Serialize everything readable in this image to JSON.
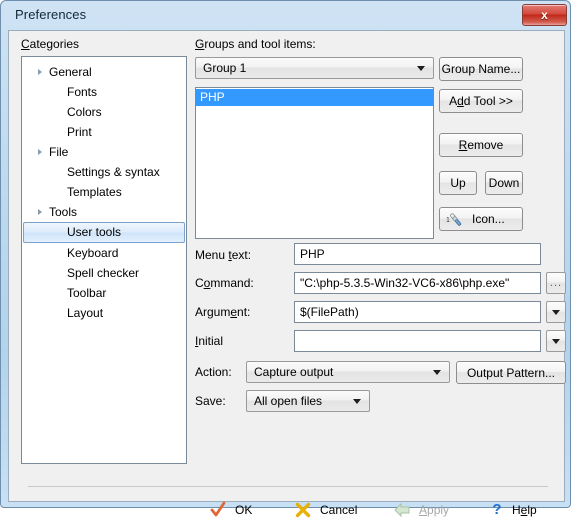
{
  "window": {
    "title": "Preferences",
    "close_label": "x",
    "close_icon": "close-icon"
  },
  "categories": {
    "label": "Categories",
    "label_accel": "C",
    "selected": "User tools",
    "items": [
      {
        "label": "General",
        "level": 0,
        "expander": "expanded-triangle-icon"
      },
      {
        "label": "Fonts",
        "level": 1,
        "expander": ""
      },
      {
        "label": "Colors",
        "level": 1,
        "expander": ""
      },
      {
        "label": "Print",
        "level": 1,
        "expander": ""
      },
      {
        "label": "File",
        "level": 0,
        "expander": "expanded-triangle-icon"
      },
      {
        "label": "Settings & syntax",
        "level": 1,
        "expander": ""
      },
      {
        "label": "Templates",
        "level": 1,
        "expander": ""
      },
      {
        "label": "Tools",
        "level": 0,
        "expander": "expanded-triangle-icon"
      },
      {
        "label": "User tools",
        "level": 1,
        "expander": ""
      },
      {
        "label": "Keyboard",
        "level": 1,
        "expander": ""
      },
      {
        "label": "Spell checker",
        "level": 1,
        "expander": ""
      },
      {
        "label": "Toolbar",
        "level": 1,
        "expander": ""
      },
      {
        "label": "Layout",
        "level": 1,
        "expander": ""
      }
    ]
  },
  "groups": {
    "label": "Groups and tool items:",
    "group_combo_value": "Group 1",
    "tool_items": [
      "PHP"
    ],
    "selected_tool": "PHP",
    "buttons": {
      "group_name": "Group Name...",
      "add_tool": "Add Tool >>",
      "remove": "Remove",
      "up": "Up",
      "down": "Down",
      "icon": "Icon...",
      "icon_glyph": "screwdriver-icon",
      "icon_number": "1"
    }
  },
  "form": {
    "menu_text_label": "Menu text:",
    "menu_text_value": "PHP",
    "command_label": "Command:",
    "command_value": "\"C:\\php-5.3.5-Win32-VC6-x86\\php.exe\"",
    "command_browse_label": "...",
    "argument_label": "Argument:",
    "argument_value": "$(FilePath)",
    "initial_label": "Initial",
    "initial_value": "",
    "action_label": "Action:",
    "action_value": "Capture output",
    "output_pattern_label": "Output Pattern...",
    "save_label": "Save:",
    "save_value": "All open files"
  },
  "footer": {
    "ok": "OK",
    "cancel": "Cancel",
    "apply": "Apply",
    "help": "Help",
    "ok_icon": "checkmark-icon",
    "cancel_icon": "cross-icon",
    "apply_icon": "left-arrow-icon",
    "help_icon": "question-mark-icon"
  },
  "colors": {
    "selection_blue": "#3399ff",
    "title_blue": "#bcd9ef",
    "close_red": "#c0291c",
    "accent_check": "#e06636",
    "accent_cross": "#e8b10a",
    "accent_help": "#1f6fd0"
  }
}
